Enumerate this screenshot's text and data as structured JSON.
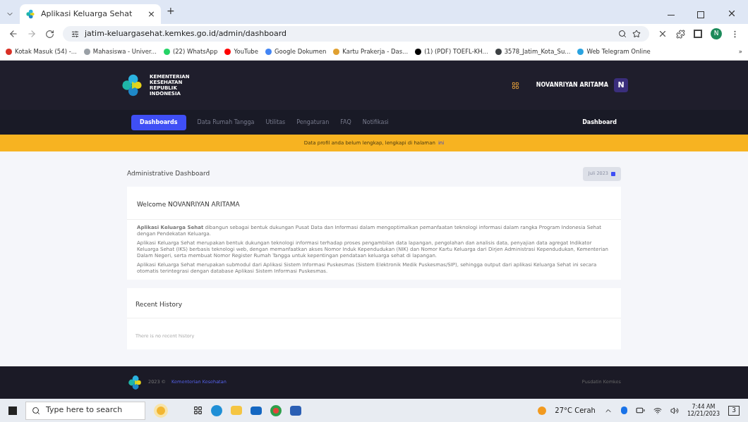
{
  "browser": {
    "tab_title": "Aplikasi Keluarga Sehat",
    "tab_close": "×",
    "new_tab": "+",
    "url": "jatim-keluargasehat.kemkes.go.id/admin/dashboard",
    "profile_initial": "N",
    "bookmarks": [
      {
        "label": "Kotak Masuk (54) -...",
        "color": "#d93025"
      },
      {
        "label": "Mahasiswa - Univer...",
        "color": "#9aa0a6"
      },
      {
        "label": "(22) WhatsApp",
        "color": "#25d366"
      },
      {
        "label": "YouTube",
        "color": "#ff0000"
      },
      {
        "label": "Google Dokumen",
        "color": "#4285f4"
      },
      {
        "label": "Kartu Prakerja - Das...",
        "color": "#e0a030"
      },
      {
        "label": "(1) (PDF) TOEFL-KH...",
        "color": "#000000"
      },
      {
        "label": "3578_Jatim_Kota_Su...",
        "color": "#3c4043"
      },
      {
        "label": "Web Telegram Online",
        "color": "#2aa3e0"
      }
    ],
    "more": "»"
  },
  "header": {
    "logo_text": "KEMENTERIAN KESEHATAN REPUBLIK INDONESIA",
    "user_name": "NOVANRIYAN ARITAMA",
    "avatar": "N"
  },
  "nav": {
    "items": [
      {
        "label": "Dashboards",
        "selected": true
      },
      {
        "label": "Data Rumah Tangga",
        "selected": false
      },
      {
        "label": "Utilitas",
        "selected": false
      },
      {
        "label": "Pengaturan",
        "selected": false
      },
      {
        "label": "FAQ",
        "selected": false
      },
      {
        "label": "Notifikasi",
        "selected": false
      }
    ],
    "breadcrumb": "Dashboard"
  },
  "banner": {
    "text": "Data profil anda belum lengkap, lengkapi di halaman",
    "link": "ini"
  },
  "page": {
    "title": "Administrative Dashboard",
    "period": "Juli 2023",
    "welcome": {
      "title": "Welcome NOVANRIYAN ARITAMA",
      "paragraphs": [
        "**Aplikasi Keluarga Sehat** dibangun sebagai bentuk dukungan Pusat Data dan Informasi dalam mengoptimalkan pemanfaatan teknologi informasi dalam rangka Program Indonesia Sehat dengan Pendekatan Keluarga.",
        "Aplikasi Keluarga Sehat merupakan bentuk dukungan teknologi informasi terhadap proses pengambilan data lapangan, pengolahan dan analisis data, penyajian data agregat Indikator Keluarga Sehat (IKS) berbasis teknologi web, dengan memanfaatkan akses Nomor Induk Kependudukan (NIK) dan Nomor Kartu Keluarga dari Dirjen Administrasi Kependudukan, Kementerian Dalam Negeri, serta membuat Nomor Register Rumah Tangga untuk kepentingan pendataan keluarga sehat di lapangan.",
        "Aplikasi Keluarga Sehat merupakan submodul dari Aplikasi Sistem Informasi Puskesmas (Sistem Elektronik Medik Puskesmas/SIP), sehingga output dari aplikasi Keluarga Sehat ini secara otomatis terintegrasi dengan database Aplikasi Sistem Informasi Puskesmas."
      ]
    },
    "history": {
      "title": "Recent History",
      "empty": "There is no recent history"
    }
  },
  "footer": {
    "year": "2023 ©",
    "org": "Kementerian Kesehatan",
    "right": "Pusdatin Kemkes"
  },
  "taskbar": {
    "search_placeholder": "Type here to search",
    "weather": "27°C  Cerah",
    "time": "7:44 AM",
    "date": "12/21/2023",
    "notifications": "3"
  }
}
